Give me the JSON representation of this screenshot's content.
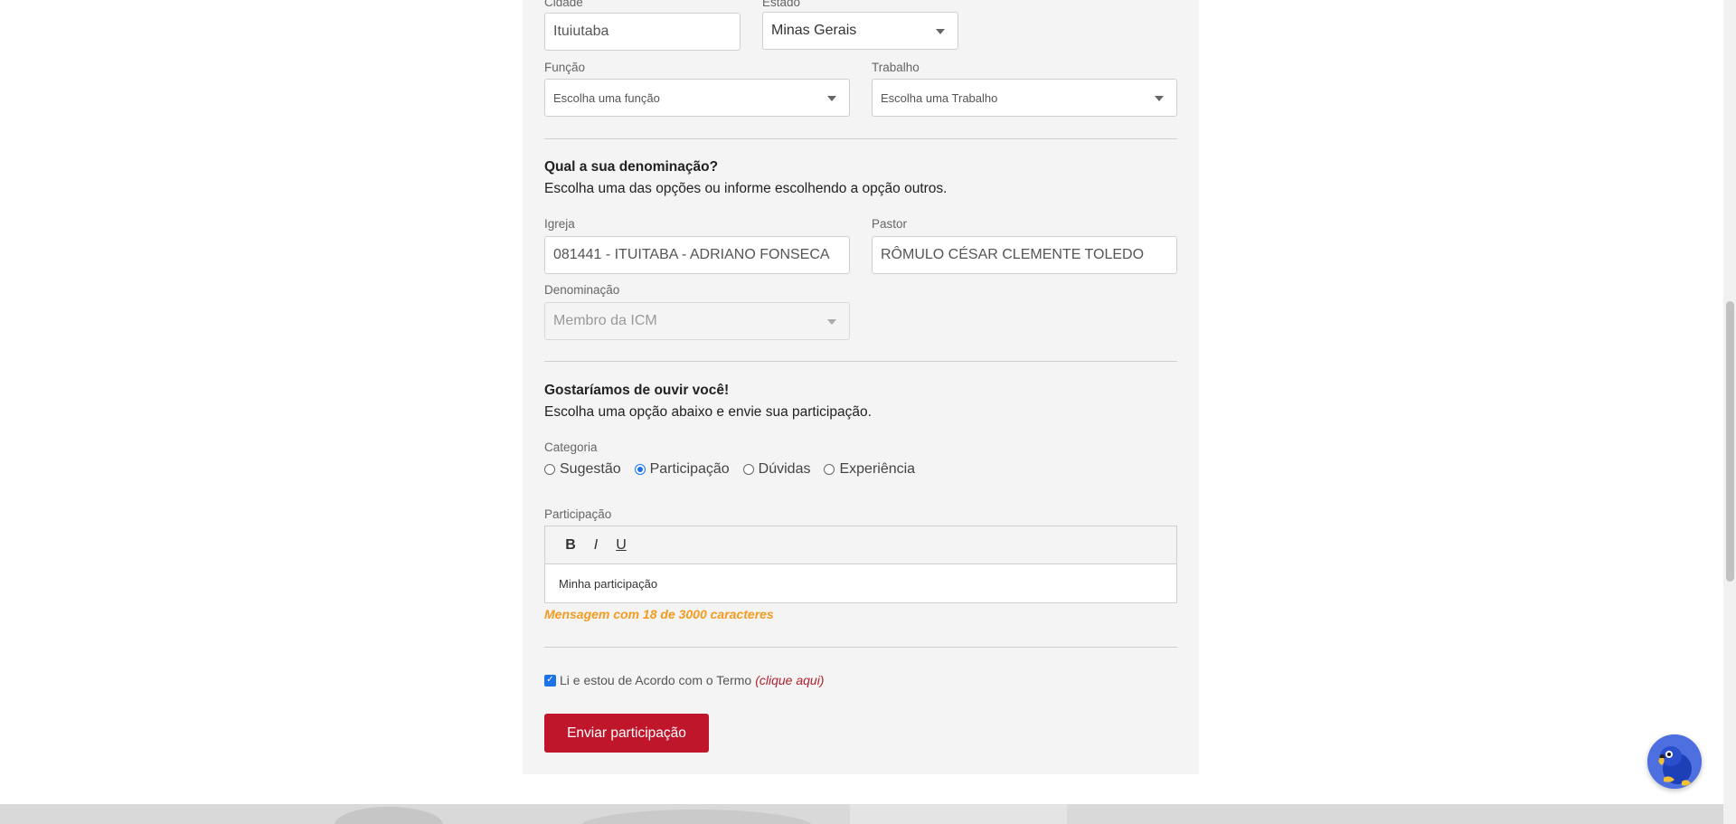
{
  "form": {
    "cidade": {
      "label": "Cidade",
      "value": "Ituiutaba"
    },
    "estado": {
      "label": "Estado",
      "value": "Minas Gerais"
    },
    "funcao": {
      "label": "Função",
      "value": "Escolha uma função"
    },
    "trabalho": {
      "label": "Trabalho",
      "value": "Escolha uma Trabalho"
    },
    "denominacao_section": {
      "title": "Qual a sua denominação?",
      "subtitle": "Escolha uma das opções ou informe escolhendo a opção outros."
    },
    "igreja": {
      "label": "Igreja",
      "value": "081441 - ITUITABA - ADRIANO FONSECA"
    },
    "pastor": {
      "label": "Pastor",
      "value": "RÔMULO CÉSAR CLEMENTE TOLEDO"
    },
    "denominacao": {
      "label": "Denominação",
      "value": "Membro da ICM"
    },
    "ouvir_section": {
      "title": "Gostaríamos de ouvir você!",
      "subtitle": "Escolha uma opção abaixo e envie sua participação."
    },
    "categoria": {
      "label": "Categoria",
      "options": [
        "Sugestão",
        "Participação",
        "Dúvidas",
        "Experiência"
      ],
      "selected": "Participação"
    },
    "participacao": {
      "label": "Participação",
      "toolbar": {
        "bold": "B",
        "italic": "I",
        "underline": "U"
      },
      "content": "Minha participação",
      "counter": "Mensagem com 18 de 3000 caracteres"
    },
    "terms": {
      "text": "Li e estou de Acordo com o Termo",
      "link": "(clique aqui)",
      "checked": true
    },
    "submit_label": "Enviar participação"
  },
  "colors": {
    "accent": "#c0162b",
    "counter": "#f49b1f",
    "link": "#b0202e",
    "radio": "#1a73e8"
  }
}
